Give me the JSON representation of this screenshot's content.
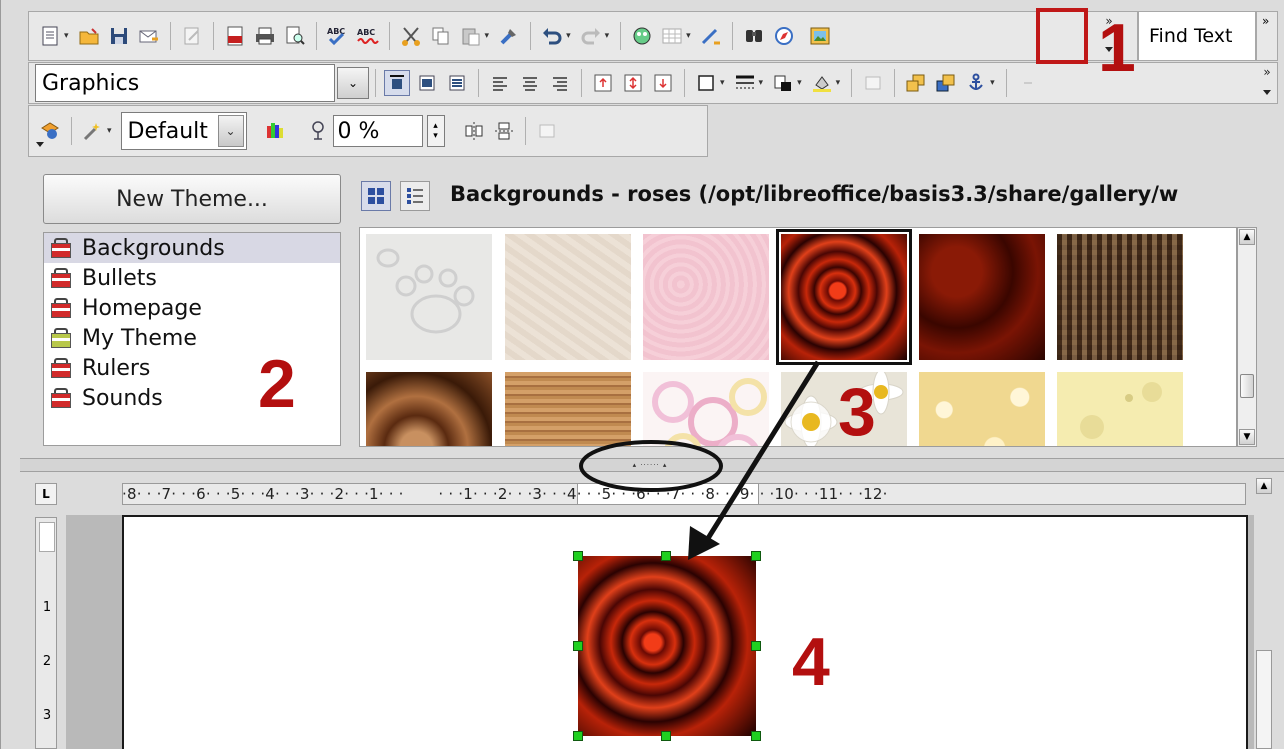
{
  "toolbar_standard": {
    "find_text_label": "Find Text",
    "icons": [
      "new-document-icon",
      "open-icon",
      "save-icon",
      "email-icon",
      "edit-file-icon",
      "export-pdf-icon",
      "print-icon",
      "page-preview-icon",
      "spellcheck-icon",
      "autospellcheck-icon",
      "cut-icon",
      "copy-icon",
      "paste-icon",
      "clone-formatting-icon",
      "undo-icon",
      "redo-icon",
      "navigator-icon",
      "table-icon",
      "draw-functions-icon",
      "find-replace-icon",
      "navigator-compass-icon",
      "gallery-icon"
    ]
  },
  "toolbar_frame": {
    "style_name": "Graphics"
  },
  "toolbar_image": {
    "filter_mode": "Default",
    "transparency": "0 %"
  },
  "gallery": {
    "new_theme_button": "New Theme...",
    "themes": [
      {
        "label": "Backgrounds",
        "selected": true,
        "color": "red"
      },
      {
        "label": "Bullets",
        "selected": false,
        "color": "red"
      },
      {
        "label": "Homepage",
        "selected": false,
        "color": "red"
      },
      {
        "label": "My Theme",
        "selected": false,
        "color": "green"
      },
      {
        "label": "Rulers",
        "selected": false,
        "color": "red"
      },
      {
        "label": "Sounds",
        "selected": false,
        "color": "red"
      }
    ],
    "title": "Backgrounds - roses (/opt/libreoffice/basis3.3/share/gallery/w",
    "thumbnails": [
      "paws",
      "cream-paper",
      "pink-paper",
      "roses",
      "dark-red",
      "burlap",
      "brown-swirl",
      "wood",
      "rings",
      "daisies",
      "popcorn",
      "cheese"
    ],
    "selected_thumbnail": "roses"
  },
  "ruler": {
    "horizontal_labels": "·8· · ·7· · ·6· · ·5· · ·4· · ·3· · ·2· · ·1· · ·       · · ·1· · ·2· · ·3· · ·4· · ·5· · ·6· · ·7· · ·8· · ·9· · ·10· · ·11· · ·12·",
    "vertical_labels": [
      "1",
      "2",
      "3"
    ],
    "corner": "L"
  },
  "annotations": {
    "step1": "1",
    "step2": "2",
    "step3": "3",
    "step4": "4"
  },
  "colors": {
    "annotation_red": "#b30f0f",
    "handle_green": "#20d020",
    "selection_bg": "#d8d8e4"
  }
}
